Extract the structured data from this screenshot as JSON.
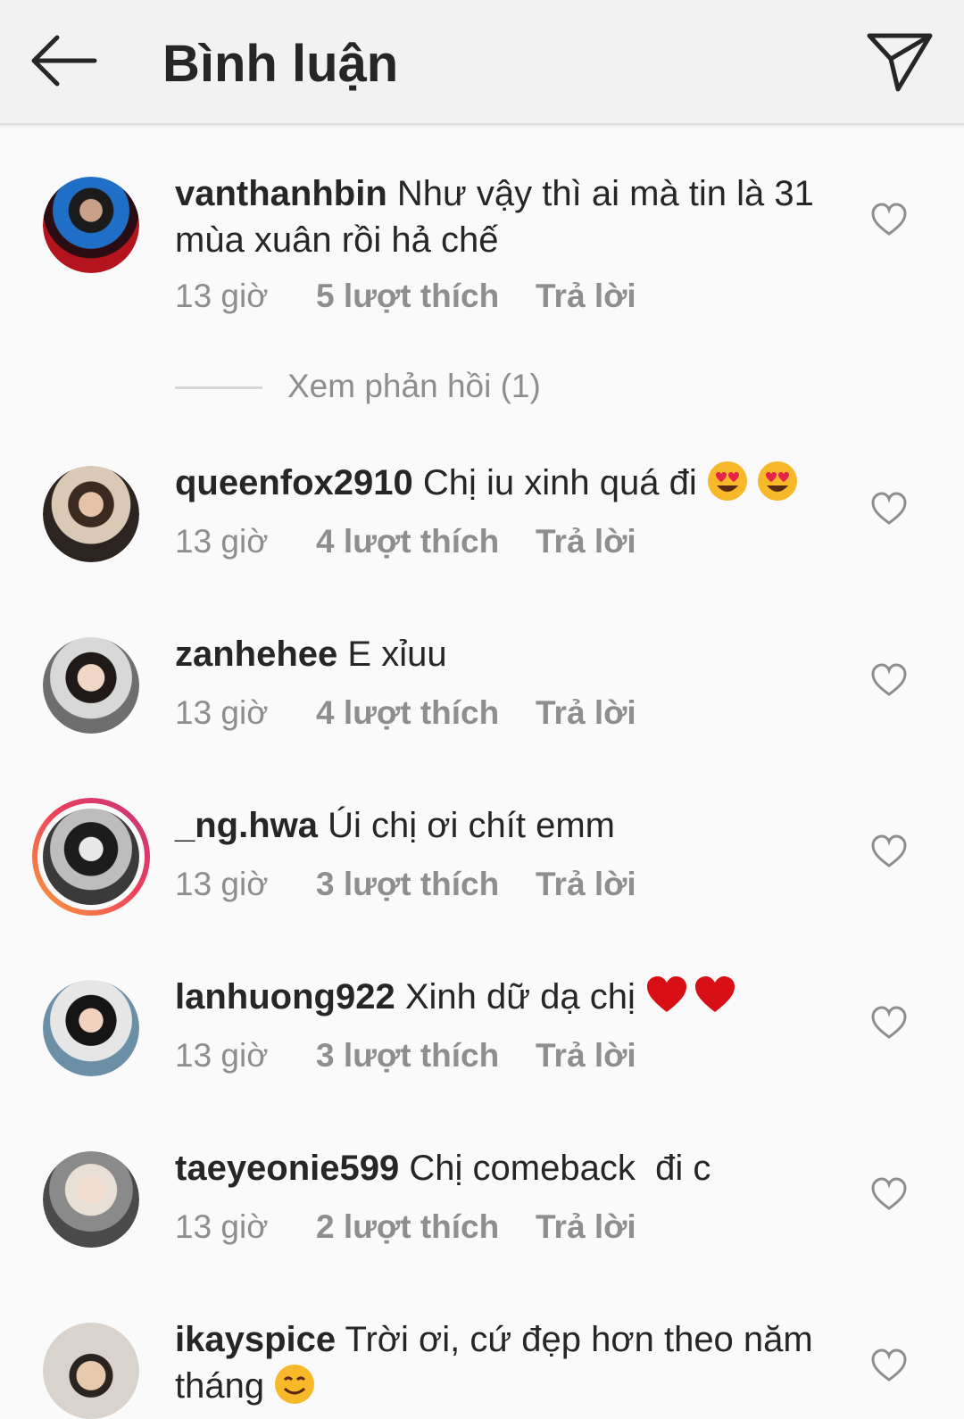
{
  "header": {
    "title": "Bình luận",
    "back_icon": "arrow-left-icon",
    "send_icon": "paper-plane-icon"
  },
  "view_replies": "Xem phản hồi (1)",
  "comments": [
    {
      "username": "vanthanhbin",
      "text": "Như vậy thì ai mà tin là 31 mùa xuân rồi hả chế",
      "time": "13 giờ",
      "likes": "5 lượt thích",
      "reply": "Trả lời"
    },
    {
      "username": "queenfox2910",
      "text": "Chị iu xinh quá đi",
      "emoji": "😍😍",
      "time": "13 giờ",
      "likes": "4 lượt thích",
      "reply": "Trả lời"
    },
    {
      "username": "zanhehee",
      "text": "E xỉuu",
      "time": "13 giờ",
      "likes": "4 lượt thích",
      "reply": "Trả lời"
    },
    {
      "username": "_ng.hwa",
      "text": "Úi chị ơi chít emm",
      "time": "13 giờ",
      "likes": "3 lượt thích",
      "reply": "Trả lời"
    },
    {
      "username": "lanhuong922",
      "text": "Xinh dữ dạ chị",
      "emoji": "❤️❤️",
      "time": "13 giờ",
      "likes": "3 lượt thích",
      "reply": "Trả lời"
    },
    {
      "username": "taeyeonie599",
      "text": "Chị comeback  đi c",
      "time": "13 giờ",
      "likes": "2 lượt thích",
      "reply": "Trả lời"
    },
    {
      "username": "ikayspice",
      "text": "Trời ơi, cứ đẹp hơn theo năm tháng",
      "emoji": "😊"
    }
  ],
  "colors": {
    "text": "#262626",
    "secondary": "#8e8e8e",
    "story_ring_start": "#f9a23a",
    "story_ring_end": "#c3337f"
  }
}
